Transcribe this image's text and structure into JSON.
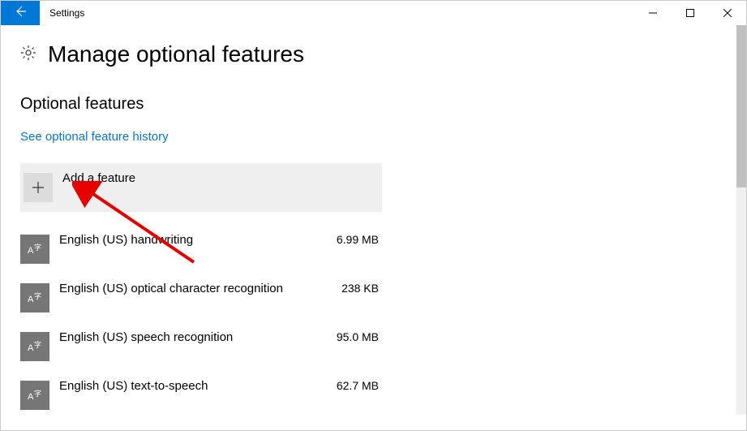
{
  "titlebar": {
    "title": "Settings"
  },
  "page": {
    "title": "Manage optional features",
    "section_title": "Optional features",
    "history_link": "See optional feature history",
    "add_label": "Add a feature"
  },
  "features": [
    {
      "name": "English (US) handwriting",
      "size": "6.99 MB"
    },
    {
      "name": "English (US) optical character recognition",
      "size": "238 KB"
    },
    {
      "name": "English (US) speech recognition",
      "size": "95.0 MB"
    },
    {
      "name": "English (US) text-to-speech",
      "size": "62.7 MB"
    }
  ]
}
